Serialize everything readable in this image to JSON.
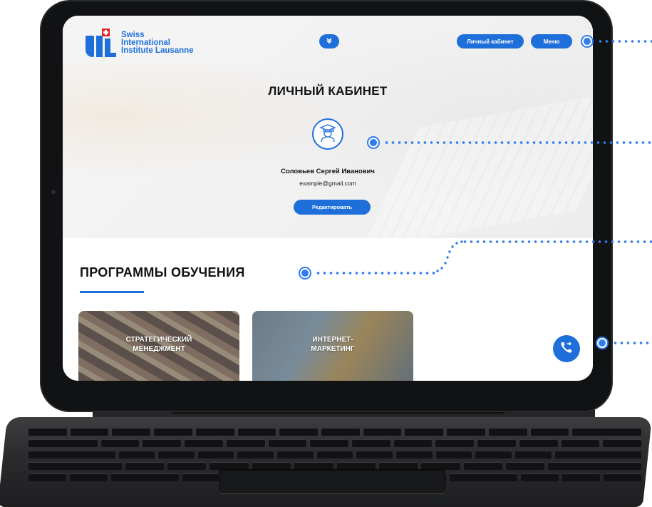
{
  "logo": {
    "line1": "Swiss",
    "line2": "International",
    "line3": "Institute Lausanne"
  },
  "header": {
    "cabinet_label": "Личный кабинет",
    "menu_label": "Меню",
    "chevron_icon": "chevron-double-down-icon"
  },
  "hero": {
    "title": "ЛИЧНЫЙ КАБИНЕТ",
    "avatar_icon": "graduate-avatar-icon",
    "user_name": "Соловьев Сергей Иванович",
    "email": "example@gmail.com",
    "edit_label": "Редактировать"
  },
  "programs": {
    "title": "ПРОГРАММЫ ОБУЧЕНИЯ",
    "cards": [
      {
        "label_line1": "СТРАТЕГИЧЕСКИЙ",
        "label_line2": "МЕНЕДЖМЕНТ"
      },
      {
        "label_line1": "ИНТЕРНЕТ-",
        "label_line2": "МАРКЕТИНГ"
      }
    ]
  },
  "fab": {
    "icon": "phone-transfer-icon"
  },
  "colors": {
    "accent": "#1e6fd9",
    "callout": "#2f7df0"
  }
}
